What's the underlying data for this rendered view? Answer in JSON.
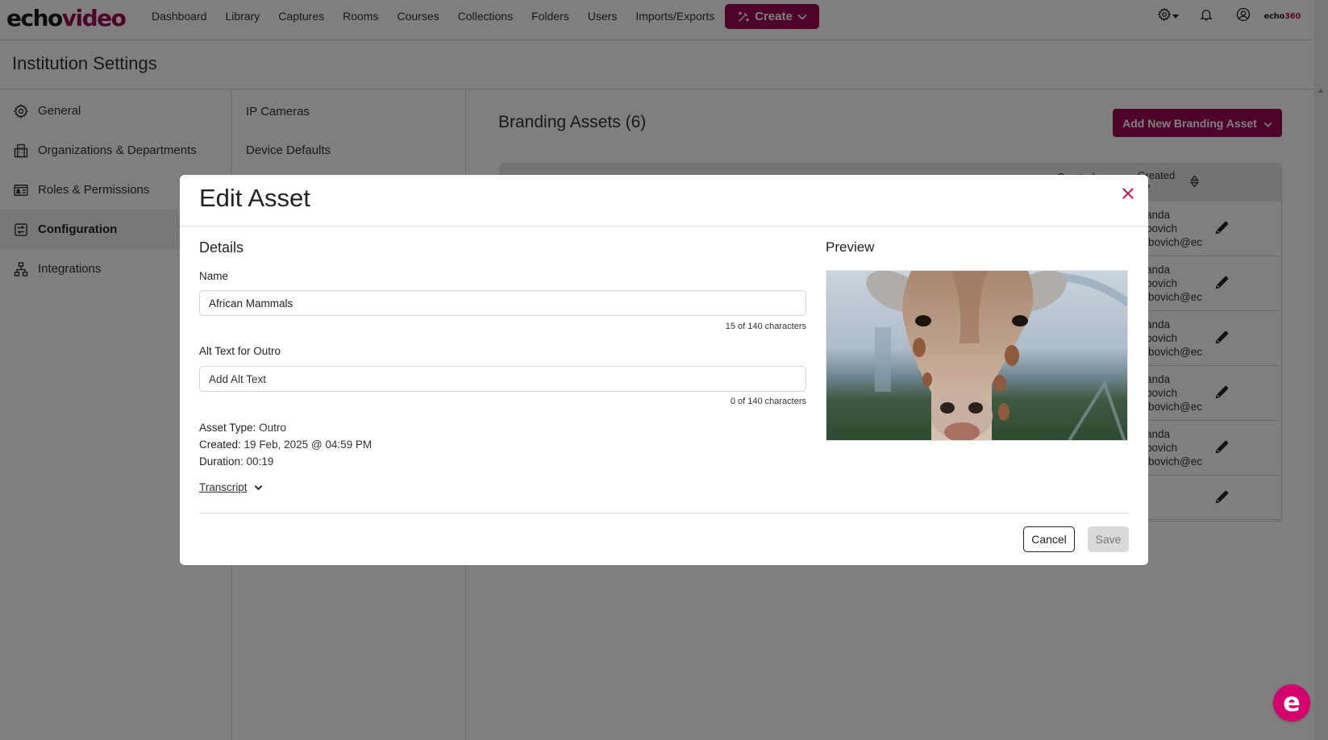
{
  "app": {
    "logo_part1": "echo",
    "logo_part2": "video",
    "brand_color": "#9b0850",
    "accent_pink": "#c4124f"
  },
  "nav": {
    "items": [
      "Dashboard",
      "Library",
      "Captures",
      "Rooms",
      "Courses",
      "Collections",
      "Folders",
      "Users",
      "Imports/Exports"
    ],
    "create_label": "Create",
    "settings_icon": "gear-icon",
    "notifications_icon": "bell-icon",
    "user_icon": "user-circle-icon",
    "partner_logo_a": "echo",
    "partner_logo_b": "360"
  },
  "page": {
    "title": "Institution Settings"
  },
  "sidebar": {
    "items": [
      {
        "label": "General",
        "icon": "gear-icon",
        "active": false
      },
      {
        "label": "Organizations & Departments",
        "icon": "building-icon",
        "active": false
      },
      {
        "label": "Roles & Permissions",
        "icon": "id-card-icon",
        "active": false
      },
      {
        "label": "Configuration",
        "icon": "sliders-icon",
        "active": true
      },
      {
        "label": "Integrations",
        "icon": "network-icon",
        "active": false
      }
    ]
  },
  "subnav": {
    "items": [
      "IP Cameras",
      "Device Defaults"
    ]
  },
  "main": {
    "title": "Branding Assets (6)",
    "add_button_label": "Add New Branding Asset",
    "table": {
      "headers": [
        "Created",
        "Created By"
      ],
      "rows": [
        {
          "created_by": [
            "anda",
            "bovich",
            "ibovich@ec"
          ]
        },
        {
          "created_by": [
            "anda",
            "bovich",
            "ibovich@ec"
          ]
        },
        {
          "created_by": [
            "anda",
            "bovich",
            "ibovich@ec"
          ]
        },
        {
          "created_by": [
            "anda",
            "bovich",
            "ibovich@ec"
          ]
        },
        {
          "created_by": [
            "anda",
            "bovich",
            "ibovich@ec"
          ]
        },
        {
          "created_by": [
            "",
            "",
            ""
          ]
        }
      ]
    }
  },
  "modal": {
    "title": "Edit Asset",
    "details_heading": "Details",
    "name_label": "Name",
    "name_value": "African Mammals",
    "name_counter": "15 of 140 characters",
    "alt_label": "Alt Text for Outro",
    "alt_value": "",
    "alt_placeholder": "Add Alt Text",
    "alt_counter": "0 of 140 characters",
    "asset_type_label": "Asset Type:",
    "asset_type_value": "Outro",
    "created_label": "Created:",
    "created_value": "19 Feb, 2025 @ 04:59 PM",
    "duration_label": "Duration:",
    "duration_value": "00:19",
    "transcript_label": "Transcript",
    "preview_heading": "Preview",
    "preview_alt": "Giraffe close-up",
    "cancel_label": "Cancel",
    "save_label": "Save"
  },
  "chat": {
    "label": "e"
  }
}
